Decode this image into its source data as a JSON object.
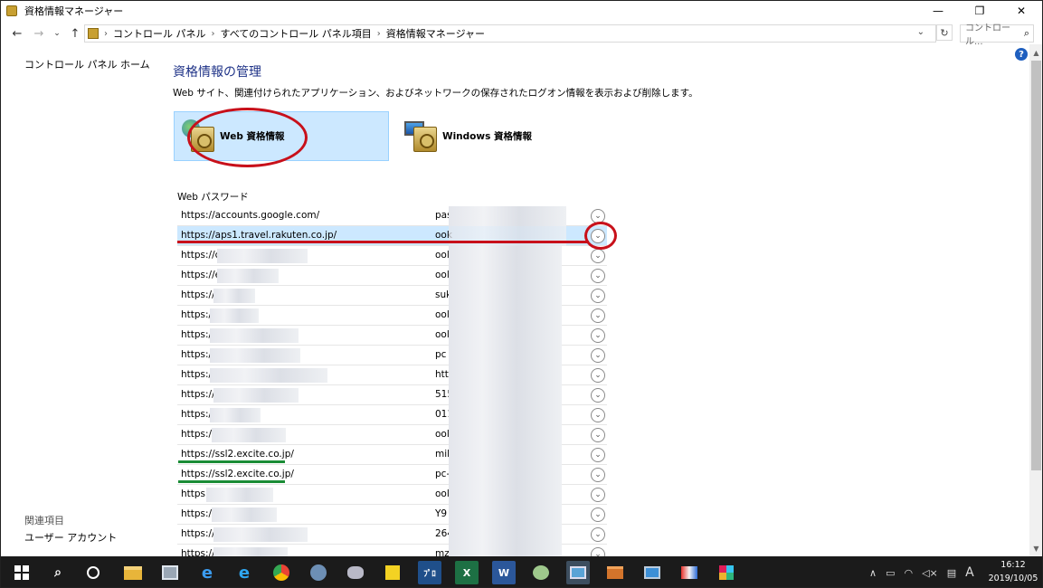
{
  "window": {
    "title": "資格情報マネージャー",
    "controls": {
      "minimize": "—",
      "restore": "❐",
      "close": "✕"
    }
  },
  "address": {
    "crumbs": [
      "コントロール パネル",
      "すべてのコントロール パネル項目",
      "資格情報マネージャー"
    ],
    "search_placeholder": "コントロール...",
    "icons": {
      "back": "back-arrow-icon",
      "forward": "forward-arrow-icon",
      "recent": "chevron-down-icon",
      "up": "up-arrow-icon",
      "refresh": "refresh-icon",
      "search": "search-icon"
    }
  },
  "left_nav": {
    "home_link": "コントロール パネル ホーム",
    "related_title": "関連項目",
    "related_link": "ユーザー アカウント"
  },
  "main": {
    "title": "資格情報の管理",
    "description": "Web サイト、関連付けられたアプリケーション、およびネットワークの保存されたログオン情報を表示および削除します。",
    "tiles": [
      {
        "label": "Web 資格情報",
        "selected": true
      },
      {
        "label": "Windows 資格情報",
        "selected": false
      }
    ],
    "section_title": "Web パスワード"
  },
  "passwords": [
    {
      "url": "https://accounts.google.com/",
      "user": "pas"
    },
    {
      "url": "https://aps1.travel.rakuten.co.jp/",
      "user": "ook"
    },
    {
      "url": "https://cfç",
      "user": "ool"
    },
    {
      "url": "https://e",
      "user": "ool"
    },
    {
      "url": "https://",
      "user": "suk"
    },
    {
      "url": "https://",
      "user": "ool"
    },
    {
      "url": "https://",
      "user": "ool"
    },
    {
      "url": "https://",
      "user": "pc"
    },
    {
      "url": "https://",
      "user": "htt"
    },
    {
      "url": "https://",
      "user": "515"
    },
    {
      "url": "https://",
      "user": "011"
    },
    {
      "url": "https://",
      "user": "ool"
    },
    {
      "url": "https://ssl2.excite.co.jp/",
      "user": "mil"
    },
    {
      "url": "https://ssl2.excite.co.jp/",
      "user": "pc-"
    },
    {
      "url": "https:",
      "user": "ool"
    },
    {
      "url": "https://",
      "user": "Y9"
    },
    {
      "url": "https://",
      "user": "264"
    },
    {
      "url": "https://",
      "user": "mz"
    }
  ],
  "taskbar": {
    "apps": [
      "start",
      "search",
      "task-view",
      "file-explorer",
      "app-5",
      "edge",
      "internet-explorer",
      "chrome",
      "app-9",
      "app-10",
      "sticky-notes",
      "app-12",
      "excel",
      "word",
      "app-15",
      "control-panel",
      "app-17",
      "remote-desktop",
      "app-19",
      "slack"
    ],
    "ime": "A",
    "time": "16:12",
    "date": "2019/10/05"
  },
  "colors": {
    "accent_title": "#1e3287",
    "selection": "#cce8ff",
    "annotation_red": "#c8101a",
    "annotation_green": "#1a8c36"
  }
}
